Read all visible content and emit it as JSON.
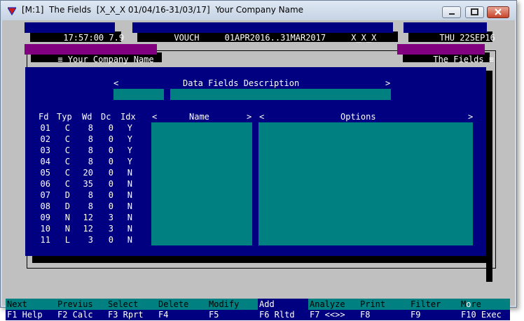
{
  "window": {
    "title": "[M:1]  The Fields  [X_X_X 01/04/16-31/03/17]  Your Company Name",
    "icon": "red-triangle-app-icon"
  },
  "statusbar": {
    "clock": "17:57:00 7.9",
    "period": "VOUCH     01APR2016..31MAR2017     X_X_X",
    "date": "THU 22SEP16"
  },
  "tags": {
    "company": "≡ Your Company Name",
    "screen": "The Fields ≡"
  },
  "panel": {
    "prev_arrow": "<",
    "next_arrow": ">",
    "heading": "Data Fields Description",
    "headers": {
      "fd": "Fd",
      "typ": "Typ",
      "wd": "Wd",
      "dc": "Dc",
      "idx": "Idx"
    },
    "name_header": {
      "left": "<",
      "label": "Name",
      "right": ">"
    },
    "options_header": {
      "left": "<",
      "label": "Options",
      "right": ">"
    }
  },
  "fields": [
    {
      "fd": "01",
      "typ": "C",
      "wd": "8",
      "dc": "0",
      "idx": "Y"
    },
    {
      "fd": "02",
      "typ": "C",
      "wd": "8",
      "dc": "0",
      "idx": "Y"
    },
    {
      "fd": "03",
      "typ": "C",
      "wd": "8",
      "dc": "0",
      "idx": "Y"
    },
    {
      "fd": "04",
      "typ": "C",
      "wd": "8",
      "dc": "0",
      "idx": "Y"
    },
    {
      "fd": "05",
      "typ": "C",
      "wd": "20",
      "dc": "0",
      "idx": "N"
    },
    {
      "fd": "06",
      "typ": "C",
      "wd": "35",
      "dc": "0",
      "idx": "N"
    },
    {
      "fd": "07",
      "typ": "D",
      "wd": "8",
      "dc": "0",
      "idx": "N"
    },
    {
      "fd": "08",
      "typ": "D",
      "wd": "8",
      "dc": "0",
      "idx": "N"
    },
    {
      "fd": "09",
      "typ": "N",
      "wd": "12",
      "dc": "3",
      "idx": "N"
    },
    {
      "fd": "10",
      "typ": "N",
      "wd": "12",
      "dc": "3",
      "idx": "N"
    },
    {
      "fd": "11",
      "typ": "L",
      "wd": "3",
      "dc": "0",
      "idx": "N"
    }
  ],
  "function_keys": [
    {
      "action": "Next",
      "key": "F1 Help"
    },
    {
      "action": "Previus",
      "key": "F2 Calc"
    },
    {
      "action": "Select",
      "key": "F3 Rprt"
    },
    {
      "action": "Delete",
      "key": "F4"
    },
    {
      "action": "Modify",
      "key": "F5"
    },
    {
      "action": "Add",
      "key": "F6 Rltd"
    },
    {
      "action": "Analyze",
      "key": "F7 <<>>"
    },
    {
      "action": "Print",
      "key": "F8"
    },
    {
      "action": "Filter",
      "key": "F9"
    },
    {
      "action_start": "M",
      "action_highlight": "o",
      "action_end": "re",
      "key": "F10 Exec"
    }
  ],
  "colors": {
    "navy": "#000080",
    "teal": "#008080",
    "purple": "#800080",
    "client_gray": "#c0c0c0"
  }
}
